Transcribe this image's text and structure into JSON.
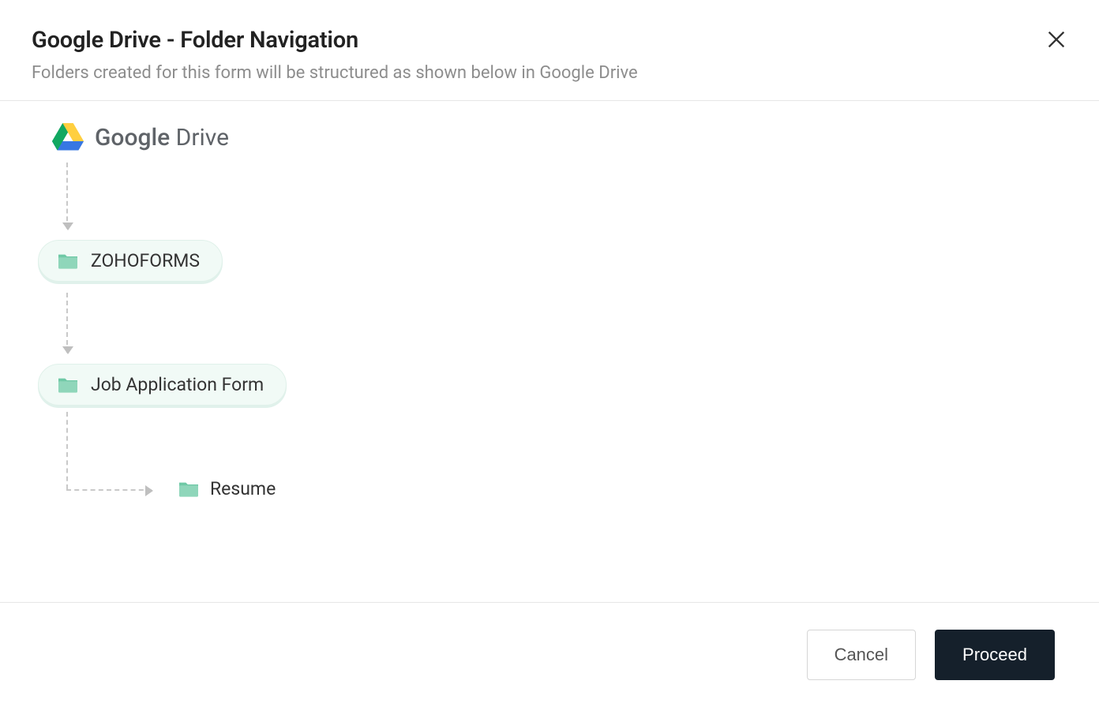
{
  "header": {
    "title": "Google Drive - Folder Navigation",
    "subtitle": "Folders created for this form will be structured as shown below in Google Drive"
  },
  "drive": {
    "brand_bold": "Google",
    "brand_light": "Drive"
  },
  "folders": {
    "level1": "ZOHOFORMS",
    "level2": "Job Application Form",
    "leaf": "Resume"
  },
  "buttons": {
    "cancel": "Cancel",
    "proceed": "Proceed"
  }
}
